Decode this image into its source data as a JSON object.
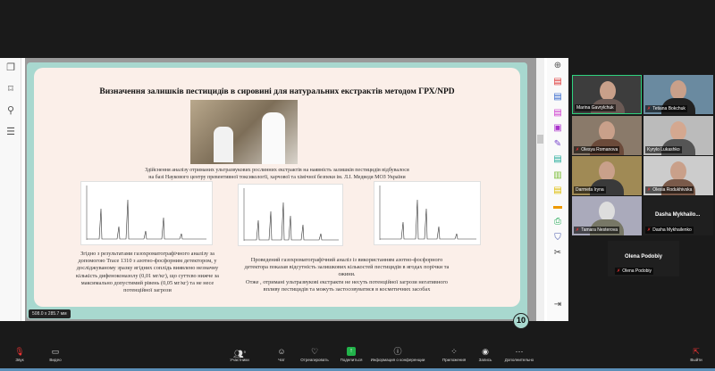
{
  "viewer": {
    "left_tools": [
      "pages-icon",
      "bookmark-icon",
      "attachment-icon",
      "layers-icon"
    ],
    "right_tools": [
      "zoom-icon",
      "export-pdf-icon",
      "create-pdf-icon",
      "organize-icon",
      "compress-icon",
      "sign-icon",
      "edit-icon",
      "scan-icon",
      "fill-icon",
      "comment-icon",
      "print-icon",
      "protect-icon",
      "more-tools-icon",
      "expand-icon"
    ],
    "page_size": "508.0 x 285.7 мм",
    "page_number": "10"
  },
  "slide": {
    "title": "Визначення залишків пестицидів в сировині для натуральних екстрактів методом ГРХ/NPD",
    "caption_line1": "Здійснення аналізу отриманих ультразвукових рослинних екстрактів на наявність залишків пестицидів відбувалося",
    "caption_line2": "на базі Наукового центру превентивної токсикології, харчової та хімічної безпеки ім. Л.І. Медведя МОЗ України",
    "left_text": "Згідно з результатами газохроматографічного аналізу за допомогою Trace 1310 з азотно-фосфорним детектором, у досліджуваному зразку ягідних соплідь виявлено незначну кількість дифеноконазолу (0,01 мг/кг), що суттєво нижче за максимально допустимий рівень (0,05 мг/кг) та не несе потенційної загрози",
    "right_text1": "Проведений газохроматографічний аналіз із використанням азотно-фосфорного детектора показав відсутність залишкових кількостей пестицидів в ягодах порічки та ожини.",
    "right_text2": "Отже , отримані ультразвукові екстракти не несуть потенційної загрози негативного впливу пестицидів та можуть застосовуватися в косметичних засобах"
  },
  "participants": [
    {
      "name": "Marina Gavrylchuk",
      "muted": false,
      "active": true
    },
    {
      "name": "Tetiana Bokchuk",
      "muted": true
    },
    {
      "name": "Olesya Romanova",
      "muted": true
    },
    {
      "name": "Kyrylo Lukashko",
      "muted": false
    },
    {
      "name": "Darmeta Iryna",
      "muted": false
    },
    {
      "name": "Olesia Rodukhivska",
      "muted": true
    },
    {
      "name": "Tamara Nesterova",
      "muted": true
    },
    {
      "name": "Dasha Mykhailenko",
      "muted": true,
      "big": "Dasha  Mykhailo..."
    },
    {
      "name": "Olena Podobiy",
      "muted": true,
      "big": "Olena Podobiy"
    }
  ],
  "toolbar": {
    "audio": "Звук",
    "video": "Видео",
    "participants": "Участники",
    "participants_count": "9",
    "chat": "Чат",
    "react": "Отреагировать",
    "share": "Поделиться",
    "info": "Информация о конференции",
    "apps": "Приложения",
    "record": "Запись",
    "more": "Дополнительно",
    "leave": "Выйти"
  }
}
